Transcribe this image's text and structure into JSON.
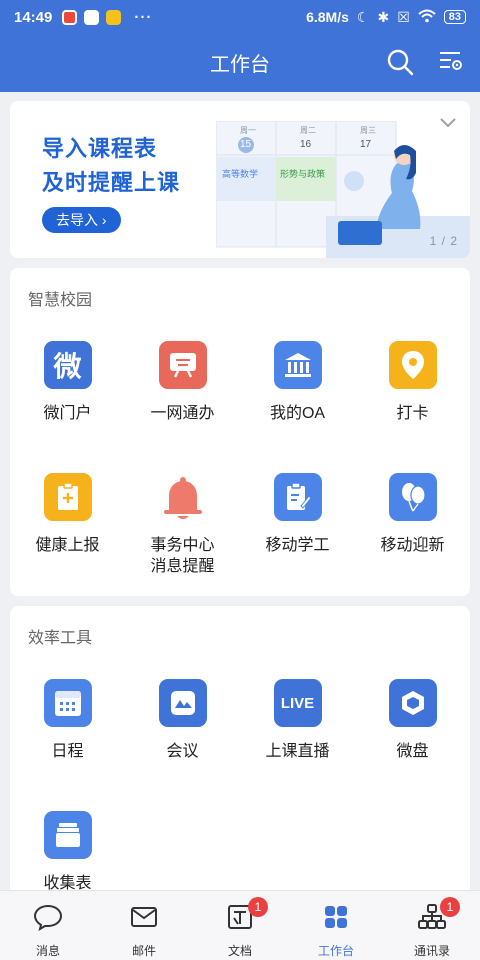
{
  "status": {
    "time": "14:49",
    "dots": "···",
    "speed": "6.8M/s",
    "battery": "83"
  },
  "header": {
    "title": "工作台"
  },
  "banner": {
    "line1": "导入课程表",
    "line2": "及时提醒上课",
    "button": "去导入",
    "pager": "1 / 2",
    "schedule": {
      "days": [
        "周一",
        "周二",
        "周三"
      ],
      "dates": [
        "15",
        "16",
        "17"
      ],
      "courses": [
        "高等数学",
        "形势与政策"
      ]
    }
  },
  "campus": {
    "title": "智慧校园",
    "items": [
      {
        "label": "微门户",
        "icon": "wei-portal-icon",
        "color": "#3f73d8"
      },
      {
        "label": "一网通办",
        "icon": "service-hall-icon",
        "color": "#e8685a"
      },
      {
        "label": "我的OA",
        "icon": "institution-icon",
        "color": "#4d84e8"
      },
      {
        "label": "打卡",
        "icon": "location-pin-icon",
        "color": "#f5b21b"
      },
      {
        "label": "健康上报",
        "icon": "health-report-icon",
        "color": "#f5b21b"
      },
      {
        "label": "事务中心\n消息提醒",
        "icon": "bell-icon",
        "color": "#ee7a6c"
      },
      {
        "label": "移动学工",
        "icon": "clipboard-edit-icon",
        "color": "#4d84e8"
      },
      {
        "label": "移动迎新",
        "icon": "balloons-icon",
        "color": "#4d84e8"
      }
    ]
  },
  "tools": {
    "title": "效率工具",
    "items": [
      {
        "label": "日程",
        "icon": "calendar-icon",
        "color": "#4d84e8"
      },
      {
        "label": "会议",
        "icon": "meeting-icon",
        "color": "#3f73d8"
      },
      {
        "label": "上课直播",
        "icon": "live-icon",
        "color": "#3f73d8",
        "text": "LIVE"
      },
      {
        "label": "微盘",
        "icon": "cloud-disk-icon",
        "color": "#3f73d8"
      },
      {
        "label": "收集表",
        "icon": "collect-form-icon",
        "color": "#4d84e8"
      }
    ]
  },
  "tabbar": [
    {
      "label": "消息",
      "icon": "chat-bubble-icon",
      "badge": ""
    },
    {
      "label": "邮件",
      "icon": "mail-icon",
      "badge": ""
    },
    {
      "label": "文档",
      "icon": "document-icon",
      "badge": "1"
    },
    {
      "label": "工作台",
      "icon": "workbench-grid-icon",
      "badge": "",
      "active": true
    },
    {
      "label": "通讯录",
      "icon": "org-chart-icon",
      "badge": "1"
    }
  ]
}
